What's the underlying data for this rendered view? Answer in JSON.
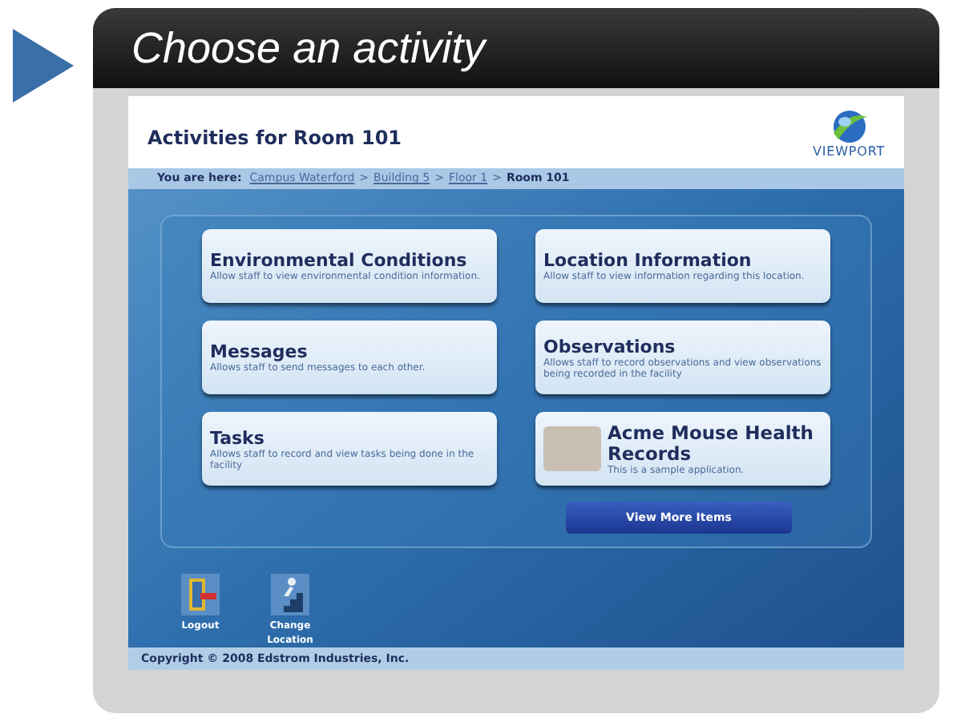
{
  "banner": {
    "title": "Choose an activity"
  },
  "header": {
    "title": "Activities for Room 101",
    "logo_text": "VIEWPORT"
  },
  "breadcrumb": {
    "label": "You are here:",
    "items": [
      {
        "kind": "link",
        "text": "Campus Waterford"
      },
      {
        "kind": "separator",
        "text": ">"
      },
      {
        "kind": "link",
        "text": "Building 5"
      },
      {
        "kind": "separator",
        "text": ">"
      },
      {
        "kind": "link",
        "text": "Floor 1"
      },
      {
        "kind": "separator",
        "text": ">"
      },
      {
        "kind": "current",
        "text": "Room 101"
      }
    ]
  },
  "activities": [
    {
      "kind": "plain",
      "title": "Environmental Conditions",
      "description": "Allow staff to view environmental condition information."
    },
    {
      "kind": "plain",
      "title": "Location Information",
      "description": "Allow staff to view information regarding this location."
    },
    {
      "kind": "plain",
      "title": "Messages",
      "description": "Allows staff to send messages to each other."
    },
    {
      "kind": "plain",
      "title": "Observations",
      "description": "Allows staff to record observations and view observations being recorded in the facility"
    },
    {
      "kind": "plain",
      "title": "Tasks",
      "description": "Allows staff to record and view tasks being done in the facility"
    },
    {
      "kind": "image",
      "title": "Acme Mouse Health Records",
      "description": "This is a sample application."
    }
  ],
  "more_button": "View More Items",
  "footer_actions": [
    {
      "kind": "logout",
      "label": "Logout"
    },
    {
      "kind": "location",
      "label": "Change Location"
    }
  ],
  "copyright": "Copyright © 2008 Edstrom Industries, Inc."
}
